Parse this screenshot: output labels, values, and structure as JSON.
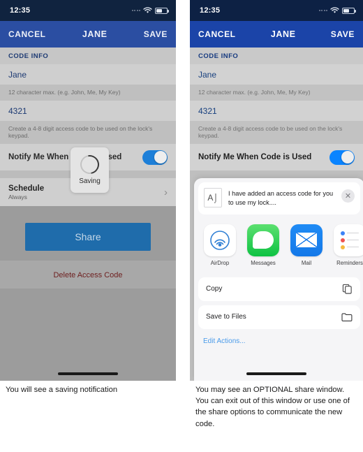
{
  "phone_left": {
    "status_bar": {
      "time": "12:35",
      "wifi_icon": "wifi-icon",
      "battery_icon": "battery-icon",
      "signal_icon": "signal-dots-icon"
    },
    "nav": {
      "cancel": "CANCEL",
      "title": "JANE",
      "save": "SAVE"
    },
    "section_header": "CODE INFO",
    "name_field_value": "Jane",
    "name_hint": "12 character max. (e.g. John, Me, My Key)",
    "code_field_value": "4321",
    "code_hint": "Create a 4-8 digit access code to be used on the lock's keypad.",
    "notify_row_label": "Notify Me When Code is Used",
    "notify_toggle_state": "on",
    "schedule_title": "Schedule",
    "schedule_value": "Always",
    "schedule_chevron": "chevron-right-icon",
    "share_button": "Share",
    "delete_link": "Delete Access Code",
    "saving_dialog": {
      "label": "Saving",
      "spinner": "spinner-icon"
    }
  },
  "phone_right": {
    "status_bar": {
      "time": "12:35",
      "wifi_icon": "wifi-icon",
      "battery_icon": "battery-icon",
      "signal_icon": "signal-dots-icon"
    },
    "nav": {
      "cancel": "CANCEL",
      "title": "JANE",
      "save": "SAVE"
    },
    "section_header": "CODE INFO",
    "name_field_value": "Jane",
    "name_hint": "12 character max. (e.g. John, Me, My Key)",
    "code_field_value": "4321",
    "code_hint": "Create a 4-8 digit access code to be used on the lock's keypad.",
    "notify_row_label": "Notify Me When Code is Used",
    "notify_toggle_state": "on",
    "share_sheet": {
      "preview_icon": "text-document-icon",
      "message": "I have added an access code for you to use my lock....",
      "close_icon": "close-icon",
      "apps": [
        {
          "name": "AirDrop",
          "icon": "airdrop-icon"
        },
        {
          "name": "Messages",
          "icon": "messages-icon"
        },
        {
          "name": "Mail",
          "icon": "mail-icon"
        },
        {
          "name": "Reminders",
          "icon": "reminders-icon"
        },
        {
          "name": "",
          "icon": "notes-icon"
        }
      ],
      "actions": [
        {
          "label": "Copy",
          "icon": "copy-icon"
        },
        {
          "label": "Save to Files",
          "icon": "folder-icon"
        }
      ],
      "edit_actions": "Edit Actions..."
    }
  },
  "captions": {
    "left": "You will see a saving notification",
    "right": "You may see an OPTIONAL share window. You can exit out of this window or use one of the share options to communicate the new code."
  },
  "colors": {
    "status_bar": "#10233f",
    "nav_bar_left": "#2b4ea2",
    "nav_bar_right": "#1b44a8",
    "share_button": "#1f6cab",
    "toggle_on": "#0a84ff",
    "delete_text": "#6e2020",
    "link_blue": "#4a9bea"
  }
}
